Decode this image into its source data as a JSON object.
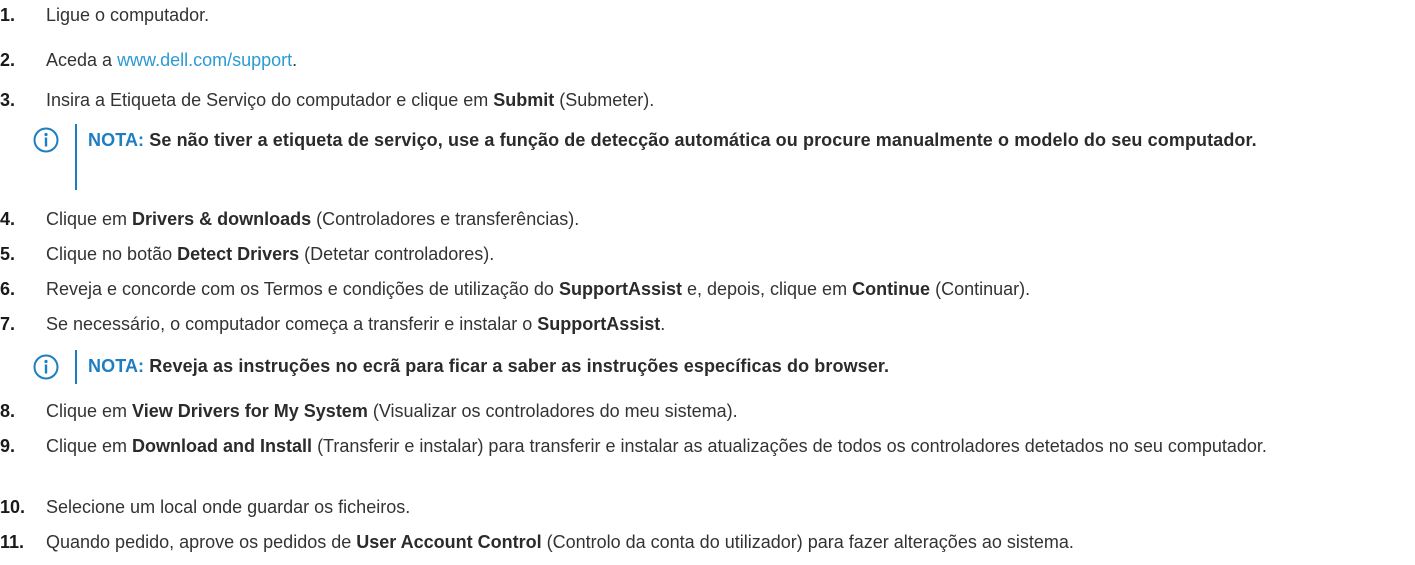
{
  "steps": [
    {
      "num": "1.",
      "parts": [
        "Ligue o computador."
      ]
    },
    {
      "num": "2.",
      "pre": "Aceda a ",
      "link": "www.dell.com/support",
      "post": "."
    },
    {
      "num": "3.",
      "pre": "Insira a Etiqueta de Serviço do computador e clique em ",
      "b1": "Submit",
      "post": " (Submeter)."
    },
    {
      "num": "4.",
      "pre": "Clique em ",
      "b1": "Drivers & downloads",
      "post": " (Controladores e transferências)."
    },
    {
      "num": "5.",
      "pre": "Clique no botão ",
      "b1": "Detect Drivers",
      "post": " (Detetar controladores)."
    },
    {
      "num": "6.",
      "pre": "Reveja e concorde com os Termos e condições de utilização do ",
      "b1": "SupportAssist",
      "mid": " e, depois, clique em ",
      "b2": "Continue",
      "post": " (Continuar)."
    },
    {
      "num": "7.",
      "pre": "Se necessário, o computador começa a transferir e instalar o ",
      "b1": "SupportAssist",
      "post": "."
    },
    {
      "num": "8.",
      "pre": "Clique em ",
      "b1": "View Drivers for My System",
      "post": " (Visualizar os controladores do meu sistema)."
    },
    {
      "num": "9.",
      "pre": "Clique em ",
      "b1": "Download and Install",
      "post": " (Transferir e instalar) para transferir e instalar as atualizações de todos os controladores detetados no seu computador."
    },
    {
      "num": "10.",
      "pre": "Selecione um local onde guardar os ficheiros."
    },
    {
      "num": "11.",
      "pre": "Quando pedido, aprove os pedidos de ",
      "b1": "User Account Control",
      "post": " (Controlo da conta do utilizador) para fazer alterações ao sistema."
    }
  ],
  "notes": [
    {
      "label": "NOTA:",
      "text": " Se não tiver a etiqueta de serviço, use a função de detecção automática ou procure manualmente o modelo do seu computador."
    },
    {
      "label": "NOTA:",
      "text": " Reveja as instruções no ecrã para ficar a saber as instruções específicas do browser."
    }
  ],
  "colors": {
    "link": "#2b9ad6",
    "note_accent": "#1d7ec2"
  },
  "icons": {
    "note": "info-circle-icon"
  }
}
